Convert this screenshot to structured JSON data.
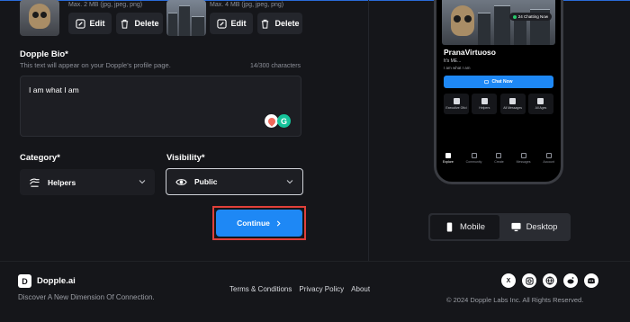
{
  "uploads": [
    {
      "hint": "Max. 2 MB (jpg, jpeg, png)",
      "edit_label": "Edit",
      "delete_label": "Delete"
    },
    {
      "hint": "Max. 4 MB (jpg, jpeg, png)",
      "edit_label": "Edit",
      "delete_label": "Delete"
    }
  ],
  "bio": {
    "label": "Dopple Bio*",
    "helper": "This text will appear on your Dopple's profile page.",
    "counter": "14/300 characters",
    "value": "I am what I am"
  },
  "category": {
    "label": "Category*",
    "value": "Helpers"
  },
  "visibility": {
    "label": "Visibility*",
    "value": "Public"
  },
  "continue_label": "Continue",
  "preview": {
    "badge": "24 Chatting Now",
    "name": "PranaVirtuoso",
    "subtitle": "It's ME...",
    "bio": "I am what I am",
    "chat_button": "Chat Now",
    "actions": [
      "Executive Ofici",
      "Helpers",
      "All Messages",
      "All Ages"
    ],
    "tabs": [
      "Explore",
      "Community",
      "Create",
      "Messages",
      "Account"
    ]
  },
  "view_toggle": {
    "mobile": "Mobile",
    "desktop": "Desktop",
    "active": "mobile"
  },
  "footer": {
    "brand": "Dopple.ai",
    "tagline": "Discover A New Dimension Of Connection.",
    "links": [
      "Terms & Conditions",
      "Privacy Policy",
      "About"
    ],
    "socials": [
      "x-icon",
      "instagram-icon",
      "globe-icon",
      "reddit-icon",
      "discord-icon"
    ],
    "copyright": "© 2024 Dopple Labs Inc. All Rights Reserved."
  },
  "colors": {
    "accent": "#1e88f5",
    "highlight_border": "#e0403a",
    "background": "#15161a"
  }
}
